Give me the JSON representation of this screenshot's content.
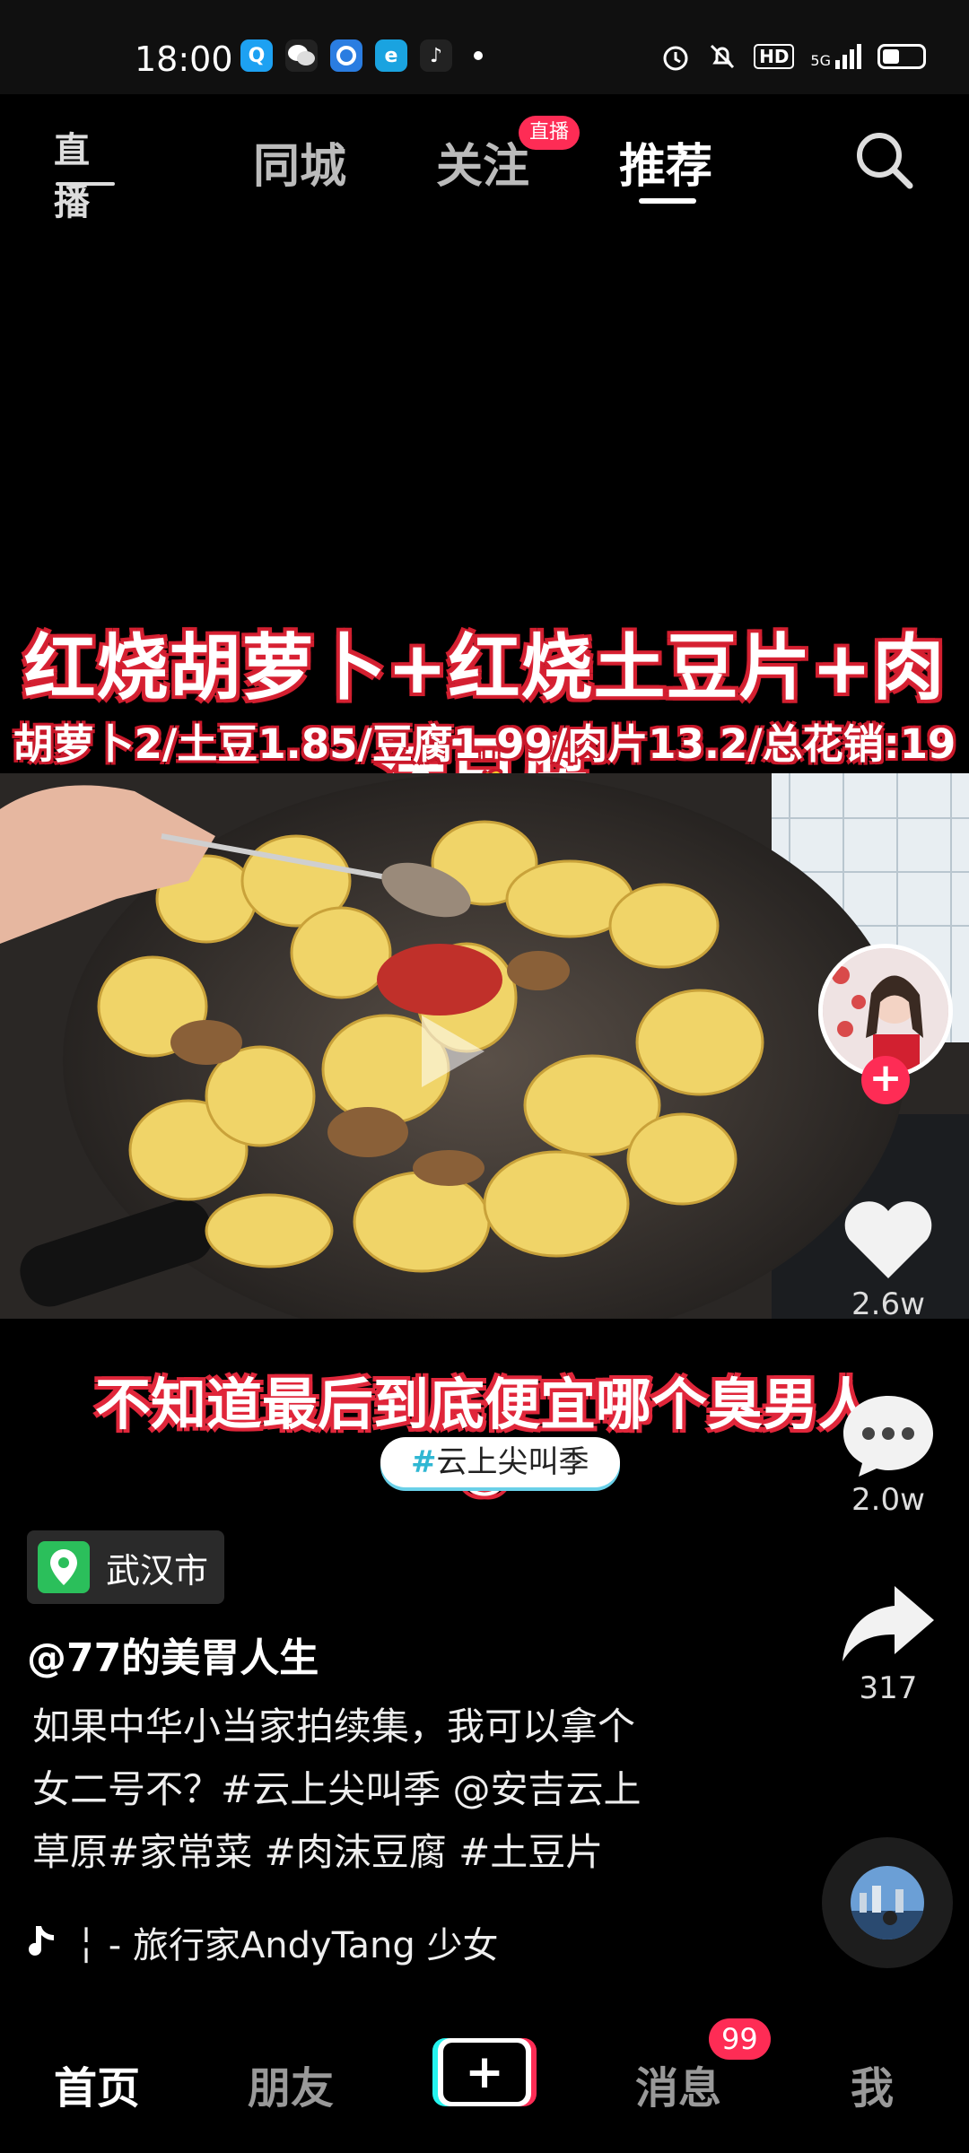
{
  "status_bar": {
    "time": "18:00",
    "apps": [
      "qq-icon",
      "wechat-icon",
      "browser-icon",
      "app-icon",
      "douyin-icon"
    ],
    "network": "5G",
    "hd": "HD"
  },
  "top_nav": {
    "live_icon_label": "直播",
    "tabs": [
      "同城",
      "关注",
      "推荐"
    ],
    "active_tab": "推荐",
    "follow_badge": "直播"
  },
  "video": {
    "title_main": "红烧胡萝卜+红烧土豆片+肉沫豆腐",
    "title_sub": "胡萝卜2/土豆1.85/豆腐1.99/肉片13.2/总花销:19💰",
    "caption": "不知道最后到底便宜哪个臭男人😂",
    "hashtag_pill": {
      "hash": "#",
      "text": "云上尖叫季"
    }
  },
  "right_rail": {
    "like_count": "2.6w",
    "comment_count": "2.0w",
    "share_count": "317"
  },
  "info": {
    "location": "武汉市",
    "author": "@77的美胃人生",
    "description_lines": [
      "如果中华小当家拍续集，我可以拿个",
      "女二号不？#云上尖叫季 @安吉云上",
      "草原#家常菜 #肉沫豆腐 #土豆片"
    ],
    "music": "╎ - 旅行家AndyTang   少女"
  },
  "bottom_nav": {
    "items": [
      "首页",
      "朋友",
      "消息",
      "我"
    ],
    "active": "首页",
    "message_badge": "99"
  }
}
